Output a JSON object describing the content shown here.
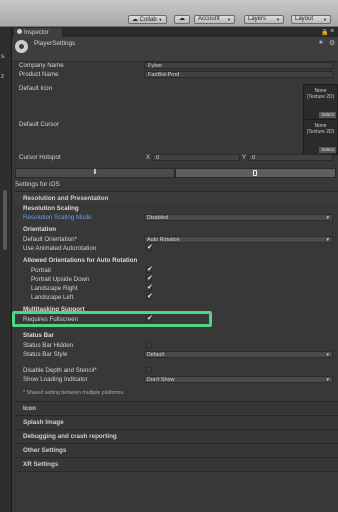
{
  "toolbar": {
    "collab": "Collab",
    "account": "Account",
    "layers": "Layers",
    "layout": "Layout"
  },
  "inspector": {
    "tab_label": "Inspector",
    "title": "PlayerSettings"
  },
  "left_margin_chars": [
    "s",
    "z"
  ],
  "fields": {
    "company_name_label": "Company Name",
    "company_name_value": "Fyber",
    "product_name_label": "Product Name",
    "product_name_value": "FairBid-Prod",
    "default_icon_label": "Default Icon",
    "default_cursor_label": "Default Cursor",
    "texture_none": "None",
    "texture_type": "(Texture 2D)",
    "select_label": "Select",
    "cursor_hotspot_label": "Cursor Hotspot",
    "x_label": "X",
    "x_value": "0",
    "y_label": "Y",
    "y_value": "0"
  },
  "settings_for": "Settings for iOS",
  "resolution": {
    "section_title": "Resolution and Presentation",
    "resolution_scaling_header": "Resolution Scaling",
    "scaling_mode_label": "Resolution Scaling Mode",
    "scaling_mode_value": "Disabled",
    "orientation_header": "Orientation",
    "default_orientation_label": "Default Orientation*",
    "default_orientation_value": "Auto Rotation",
    "animated_autorotation_label": "Use Animated Autorotation",
    "allowed_orientations_header": "Allowed Orientations for Auto Rotation",
    "portrait_label": "Portrait",
    "portrait_upside_down_label": "Portrait Upside Down",
    "landscape_right_label": "Landscape Right",
    "landscape_left_label": "Landscape Left",
    "multitasking_label": "Multitasking Support",
    "requires_fullscreen_label": "Requires Fullscreen",
    "status_bar_header": "Status Bar",
    "status_bar_hidden_label": "Status Bar Hidden",
    "status_bar_style_label": "Status Bar Style",
    "status_bar_style_value": "Default",
    "disable_depth_label": "Disable Depth and Stencil*",
    "show_loading_label": "Show Loading Indicator",
    "show_loading_value": "Don't Show",
    "shared_note": "* Shared setting between multiple platforms."
  },
  "checkboxes": {
    "animated_autorotation": true,
    "portrait": true,
    "portrait_upside_down": true,
    "landscape_right": true,
    "landscape_left": true,
    "requires_fullscreen": true,
    "status_bar_hidden": false,
    "disable_depth": false
  },
  "sections": {
    "icon": "Icon",
    "splash": "Splash Image",
    "debugging": "Debugging and crash reporting",
    "other": "Other Settings",
    "xr": "XR Settings"
  },
  "colors": {
    "highlight_box": "#4fd48a",
    "link_label": "#6f9be8"
  },
  "icons": {
    "cloud": "cloud-icon",
    "gear": "gear-icon",
    "lock": "lock-icon",
    "menu": "menu-icon",
    "download": "download-icon",
    "mobile": "mobile-icon"
  }
}
